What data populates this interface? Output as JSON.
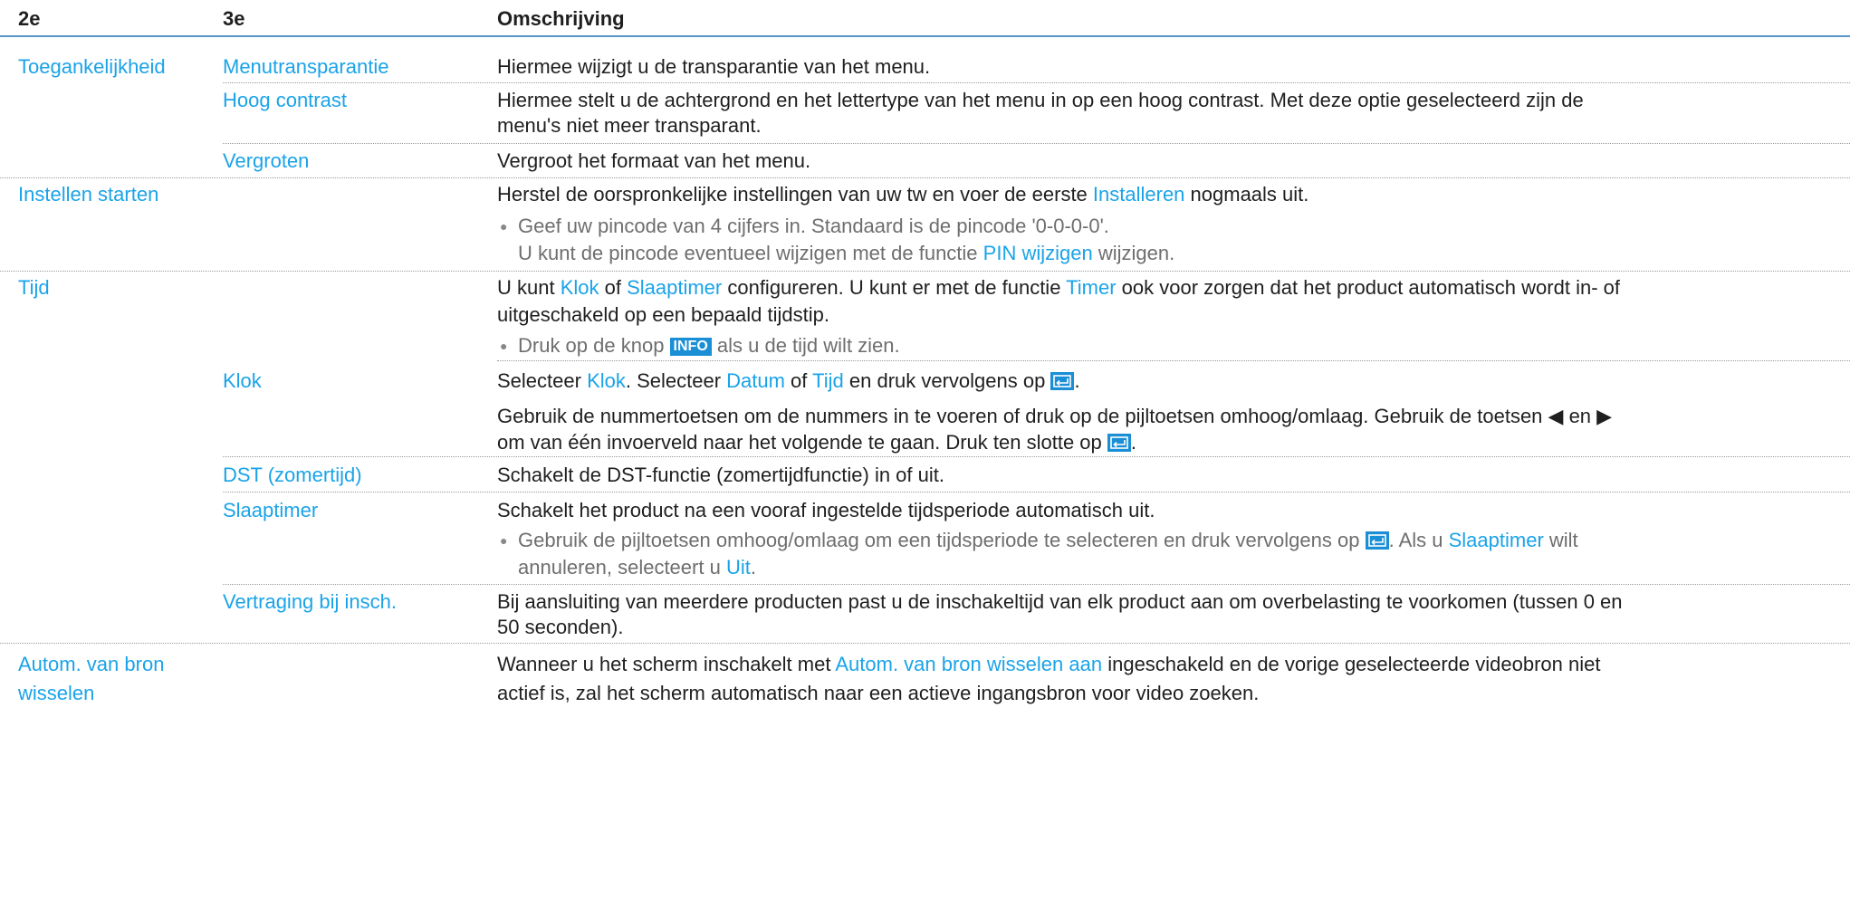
{
  "header": {
    "col1": "2e",
    "col2": "3e",
    "col3": "Omschrijving"
  },
  "rows": {
    "r1": {
      "c1": "Toegankelijkheid",
      "c2": "Menutransparantie",
      "c3": "Hiermee wijzigt u de transparantie van het menu."
    },
    "r2": {
      "c2": "Hoog contrast",
      "c3a": "Hiermee stelt u de achtergrond en het lettertype van het menu in op een hoog contrast. Met deze optie geselecteerd zijn de",
      "c3b": "menu's niet meer transparant."
    },
    "r3": {
      "c2": "Vergroten",
      "c3": "Vergroot het formaat van het menu."
    },
    "r4": {
      "c1": "Instellen starten",
      "l1a": "Herstel de oorspronkelijke instellingen van uw tw en voer de eerste ",
      "l1b": "Installeren",
      "l1c": " nogmaals uit.",
      "n1": "Geef uw pincode van 4 cijfers in. Standaard is de pincode '0-0-0-0'.",
      "n2a": "U kunt de pincode eventueel wijzigen met de functie ",
      "n2b": "PIN wijzigen",
      "n2c": " wijzigen."
    },
    "r5": {
      "c1": "Tijd",
      "l1a": "U kunt ",
      "l1b": "Klok",
      "l1c": " of ",
      "l1d": "Slaaptimer",
      "l1e": " configureren. U kunt er met de functie ",
      "l1f": "Timer",
      "l1g": " ook voor zorgen dat het product automatisch wordt in- of",
      "l2": "uitgeschakeld op een bepaald tijdstip.",
      "n1a": "Druk op de knop ",
      "n1badge": "INFO",
      "n1b": " als u de tijd wilt zien."
    },
    "r6": {
      "c2": "Klok",
      "l1a": "Selecteer ",
      "l1b": "Klok",
      "l1c": ". Selecteer ",
      "l1d": "Datum",
      "l1e": " of ",
      "l1f": "Tijd",
      "l1g": " en druk vervolgens op ",
      "l1h": ".",
      "l2": "Gebruik de nummertoetsen om de nummers in te voeren of druk op de pijltoetsen omhoog/omlaag. Gebruik de toetsen ◀ en ▶",
      "l3a": "om van één invoerveld naar het volgende te gaan. Druk ten slotte op ",
      "l3b": "."
    },
    "r7": {
      "c2": "DST (zomertijd)",
      "c3": "Schakelt de DST-functie (zomertijdfunctie) in of uit."
    },
    "r8": {
      "c2": "Slaaptimer",
      "l1": "Schakelt het product na een vooraf ingestelde tijdsperiode automatisch uit.",
      "n1a": "Gebruik de pijltoetsen omhoog/omlaag om een tijdsperiode te selecteren en druk vervolgens op ",
      "n1b": ". Als u ",
      "n1c": "Slaaptimer",
      "n1d": " wilt",
      "n2a": "annuleren, selecteert u ",
      "n2b": "Uit",
      "n2c": "."
    },
    "r9": {
      "c2": "Vertraging bij insch.",
      "l1": "Bij aansluiting van meerdere producten past u de inschakeltijd van elk product aan om overbelasting te voorkomen (tussen 0 en",
      "l2": "50 seconden)."
    },
    "r10": {
      "c1a": "Autom. van bron",
      "c1b": "wisselen",
      "l1a": "Wanneer u het scherm inschakelt met ",
      "l1b": "Autom. van bron wisselen aan",
      "l1c": " ingeschakeld en de vorige geselecteerde videobron niet",
      "l2": "actief is, zal het scherm automatisch naar een actieve ingangsbron voor video zoeken."
    }
  },
  "icons": {
    "enter": "enter-key-icon",
    "bullet": "bullet-icon"
  },
  "colors": {
    "accent": "#1aa3e8",
    "header_rule": "#5a93c8",
    "badge": "#1a8fd6"
  }
}
